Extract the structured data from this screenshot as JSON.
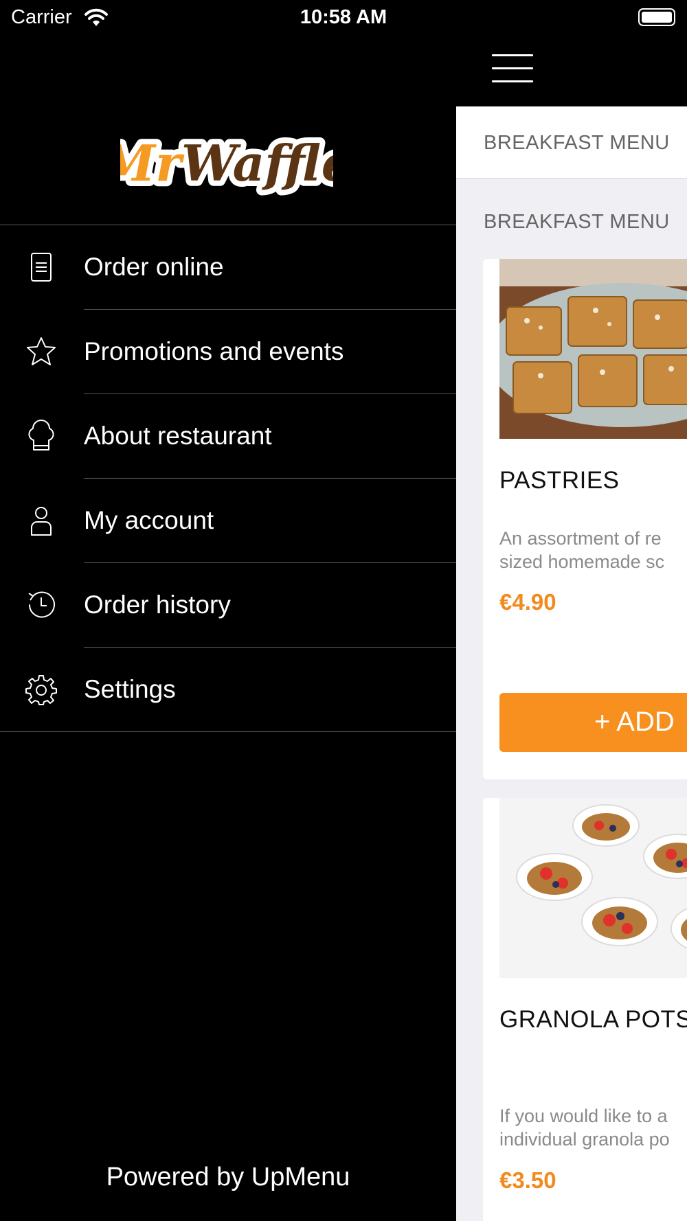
{
  "status_bar": {
    "carrier": "Carrier",
    "time": "10:58 AM"
  },
  "drawer": {
    "brand": "MrWaffle",
    "menu": [
      {
        "label": "Order online",
        "icon": "document-icon"
      },
      {
        "label": "Promotions and events",
        "icon": "star-icon"
      },
      {
        "label": "About restaurant",
        "icon": "chef-hat-icon"
      },
      {
        "label": "My account",
        "icon": "user-icon"
      },
      {
        "label": "Order history",
        "icon": "history-clock-icon"
      },
      {
        "label": "Settings",
        "icon": "gear-icon"
      }
    ],
    "footer": "Powered by UpMenu"
  },
  "content": {
    "tab_label": "BREAKFAST MENU",
    "section_label": "BREAKFAST MENU",
    "items": [
      {
        "title": "PASTRIES",
        "description_line1": "An assortment of re",
        "description_line2": "sized homemade sc",
        "price": "€4.90",
        "add_label": "+ ADD"
      },
      {
        "title": "GRANOLA POTS",
        "description_line1": "If you would like to a",
        "description_line2": "individual granola po",
        "price": "€3.50"
      }
    ]
  },
  "colors": {
    "accent": "#f7901e",
    "price": "#f28a1e",
    "drawer_bg": "#000000",
    "content_bg": "#efeff4"
  }
}
